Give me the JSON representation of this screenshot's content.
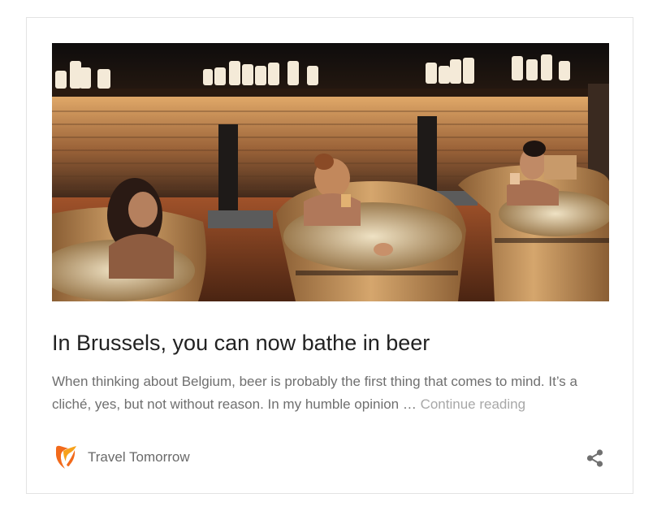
{
  "article": {
    "title": "In Brussels, you can now bathe in beer",
    "excerpt": "When thinking about Belgium, beer is probably the first thing that comes to mind. It’s a cliché, yes, but not without reason. In my humble opinion … ",
    "continue_label": "Continue reading",
    "image_description_icon": "beer-spa-photo"
  },
  "source": {
    "name": "Travel Tomorrow",
    "logo_icon": "travel-tomorrow-logo-icon",
    "logo_colors": [
      "#f26a1b",
      "#f7a21b"
    ]
  },
  "actions": {
    "share_icon": "share-icon"
  },
  "colors": {
    "title": "#222222",
    "text": "#6f6f6f",
    "link": "#a8a8a8",
    "border": "#e3e3e3"
  }
}
